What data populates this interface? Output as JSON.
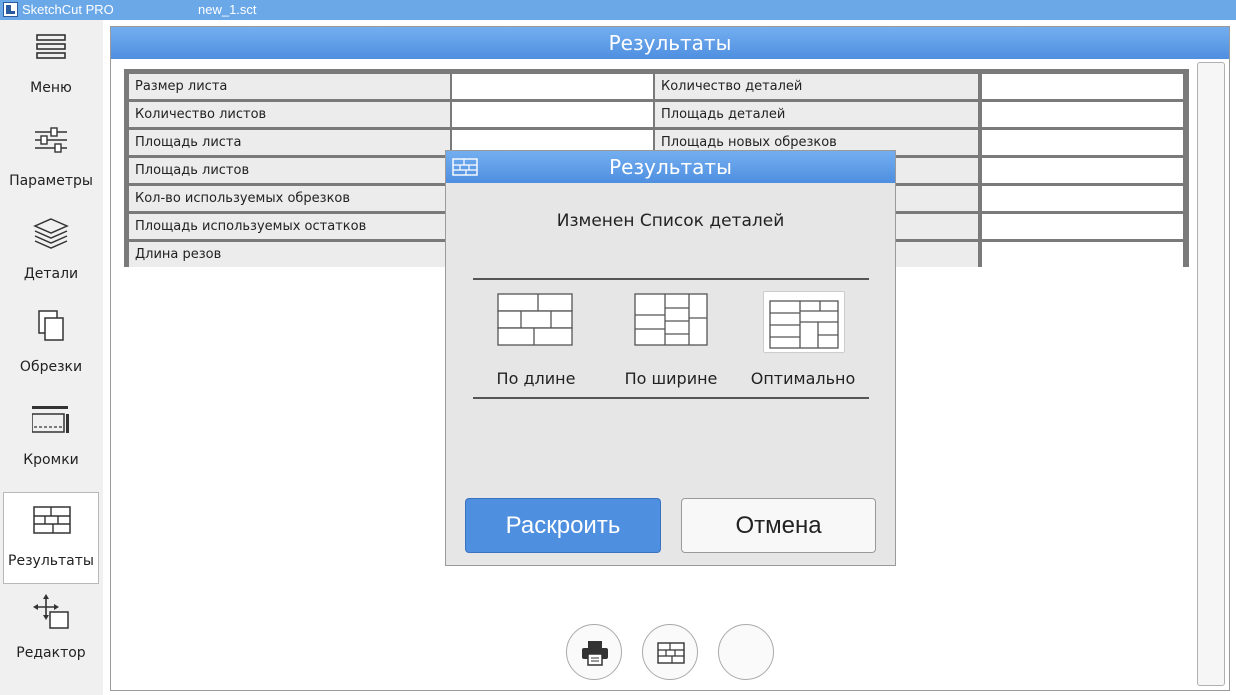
{
  "titlebar": {
    "app_name": "SketchCut PRO",
    "file_name": "new_1.sct"
  },
  "sidebar": {
    "items": [
      {
        "label": "Меню",
        "icon": "hamburger-menu-icon"
      },
      {
        "label": "Параметры",
        "icon": "sliders-icon"
      },
      {
        "label": "Детали",
        "icon": "layers-icon"
      },
      {
        "label": "Обрезки",
        "icon": "copies-icon"
      },
      {
        "label": "Кромки",
        "icon": "edge-icon"
      },
      {
        "label": "Результаты",
        "icon": "cutting-layout-icon",
        "active": true
      },
      {
        "label": "Редактор",
        "icon": "move-arrows-icon"
      }
    ]
  },
  "main": {
    "title": "Результаты",
    "table": {
      "left_labels": [
        "Размер листа",
        "Количество листов",
        "Площадь листа",
        "Площадь листов",
        "Кол-во используемых обрезков",
        "Площадь используемых остатков",
        "Длина резов"
      ],
      "right_labels": [
        "Количество деталей",
        "Площадь деталей",
        "Площадь новых обрезков",
        "",
        "",
        "",
        ""
      ]
    }
  },
  "dialog": {
    "title": "Результаты",
    "message": "Изменен Список деталей",
    "options": [
      {
        "label": "По длине",
        "icon": "by-length-layout-icon"
      },
      {
        "label": "По ширине",
        "icon": "by-width-layout-icon"
      },
      {
        "label": "Оптимально",
        "icon": "optimal-layout-icon",
        "selected": true
      }
    ],
    "primary_button": "Раскроить",
    "cancel_button": "Отмена"
  },
  "footer": {
    "buttons": [
      "print-icon",
      "cutting-layout-icon",
      "blank-circle"
    ]
  },
  "colors": {
    "accent": "#4f8fe0",
    "titlebar": "#6aa8e8",
    "table_border": "#7a7a7a"
  }
}
